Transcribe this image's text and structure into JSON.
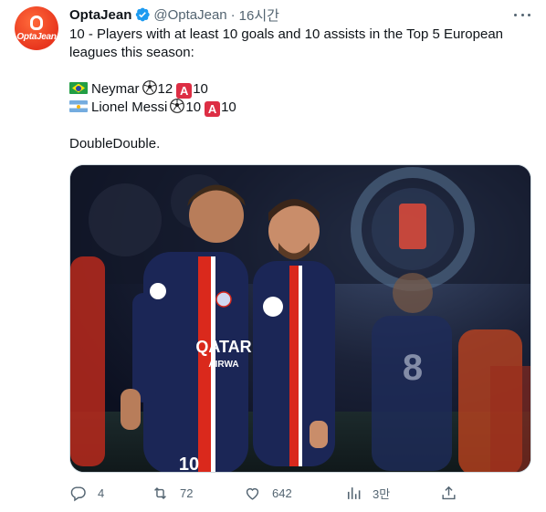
{
  "author": {
    "display_name": "OptaJean",
    "handle": "@OptaJean",
    "separator": "·",
    "time": "16시간",
    "avatar_text": "OptaJean",
    "avatar_color": "#e8361e"
  },
  "tweet": {
    "line1": "10 - Players with at least 10 goals and 10 assists in the Top 5 European",
    "line2": "leagues this season:",
    "players": [
      {
        "flag": "brazil-flag",
        "name": "Neymar",
        "goals": "12",
        "assists": "10"
      },
      {
        "flag": "argentina-flag",
        "name": "Lionel Messi",
        "goals": "10",
        "assists": "10"
      }
    ],
    "goal_icon": "soccer-ball-icon",
    "assist_badge": "A",
    "closing": "DoubleDouble."
  },
  "media": {
    "description_icon": "photo",
    "jersey_numbers": {
      "left_player": "10",
      "background_player": "8"
    },
    "sponsor_text": "QATAR",
    "sponsor_subtext": "AIRWA"
  },
  "actions": {
    "reply_count": "4",
    "retweet_count": "72",
    "like_count": "642",
    "views_count": "3만"
  },
  "colors": {
    "text": "#0f1419",
    "secondary": "#536471",
    "verified": "#1d9bf0",
    "psg_navy": "#1b2656",
    "psg_red": "#da291c"
  }
}
